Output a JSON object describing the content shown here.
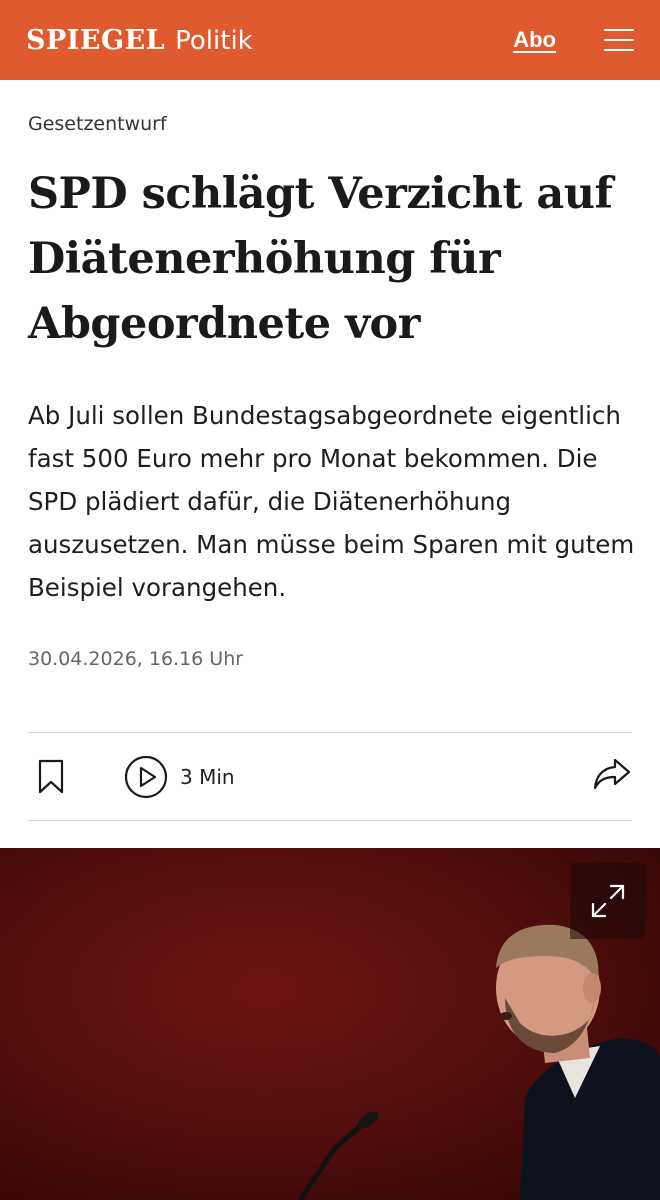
{
  "header": {
    "logo": "SPIEGEL",
    "section": "Politik",
    "abo_label": "Abo",
    "menu_icon": "hamburger-menu-icon",
    "background_color": "#e05a30"
  },
  "article": {
    "kicker": "Gesetzentwurf",
    "headline": "SPD schlägt Verzicht auf Diätenerhöhung für Abgeordnete vor",
    "lead": "Ab Juli sollen Bundestagsabgeordnete eigentlich fast 500 Euro mehr pro Monat bekommen. Die SPD plädiert dafür, die Diätenerhöhung auszusetzen. Man müsse beim Sparen mit gutem Beispiel vorangehen.",
    "date": "30.04.2026, 16.16 Uhr"
  },
  "toolbar": {
    "bookmark_icon": "bookmark-icon",
    "play_icon": "play-circle-icon",
    "audio_duration": "3 Min",
    "share_icon": "share-arrow-icon"
  },
  "hero_image": {
    "expand_icon": "expand-icon"
  }
}
